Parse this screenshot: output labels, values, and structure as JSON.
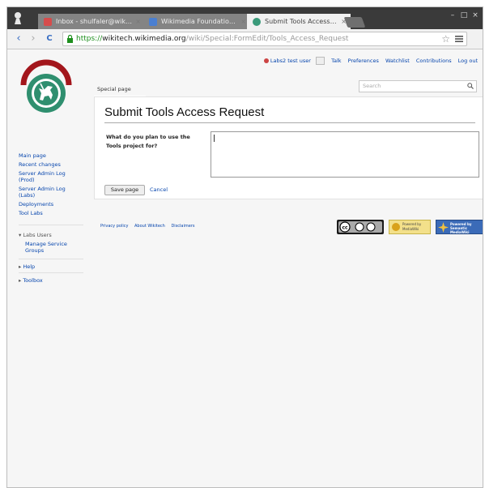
{
  "browser": {
    "tabs": [
      {
        "title": "Inbox - shulfaler@wiki…",
        "favicon_color": "#d64c4c"
      },
      {
        "title": "Wikimedia Foundation - (…",
        "favicon_color": "#4a7fd1"
      },
      {
        "title": "Submit Tools Access Req…",
        "favicon_color": "#3a9a7a"
      }
    ],
    "tab_close": "×",
    "url": {
      "scheme": "https://",
      "host": "wikitech.wikimedia.org",
      "path": "/wiki/Special:FormEdit/Tools_Access_Request"
    },
    "buttons": {
      "back": "‹",
      "forward": "›",
      "reload": "C",
      "star": "☆"
    },
    "window_controls": {
      "minimize": "–",
      "maximize": "□",
      "close": "×"
    }
  },
  "personal_tools": {
    "user": "Labs2 test user",
    "talk": "Talk",
    "preferences": "Preferences",
    "watchlist": "Watchlist",
    "contributions": "Contributions",
    "logout": "Log out"
  },
  "sidebar": {
    "nav": [
      "Main page",
      "Recent changes",
      "Server Admin Log (Prod)",
      "Server Admin Log (Labs)",
      "Deployments",
      "Tool Labs"
    ],
    "labs_users": {
      "header": "Labs Users",
      "items": [
        "Manage Service Groups"
      ]
    },
    "help": "Help",
    "toolbox": "Toolbox",
    "collapsed_arrow": "▸",
    "expanded_arrow": "▾"
  },
  "tabs": {
    "special": "Special page"
  },
  "search": {
    "placeholder": "Search"
  },
  "form": {
    "title": "Submit Tools Access Request",
    "question": "What do you plan to use the Tools project for?",
    "save_label": "Save page",
    "cancel_label": "Cancel"
  },
  "footer": {
    "links": [
      "Privacy policy",
      "About Wikitech",
      "Disclaimers"
    ],
    "badges": {
      "powered_mediawiki": "Powered by MediaWiki",
      "powered_semantic": "Powered by Semantic MediaWiki"
    }
  },
  "colors": {
    "link": "#0645ad",
    "logo_ring": "#a3161c",
    "logo_green": "#2f8f6f",
    "tabstrip": "#3a3a3a"
  }
}
